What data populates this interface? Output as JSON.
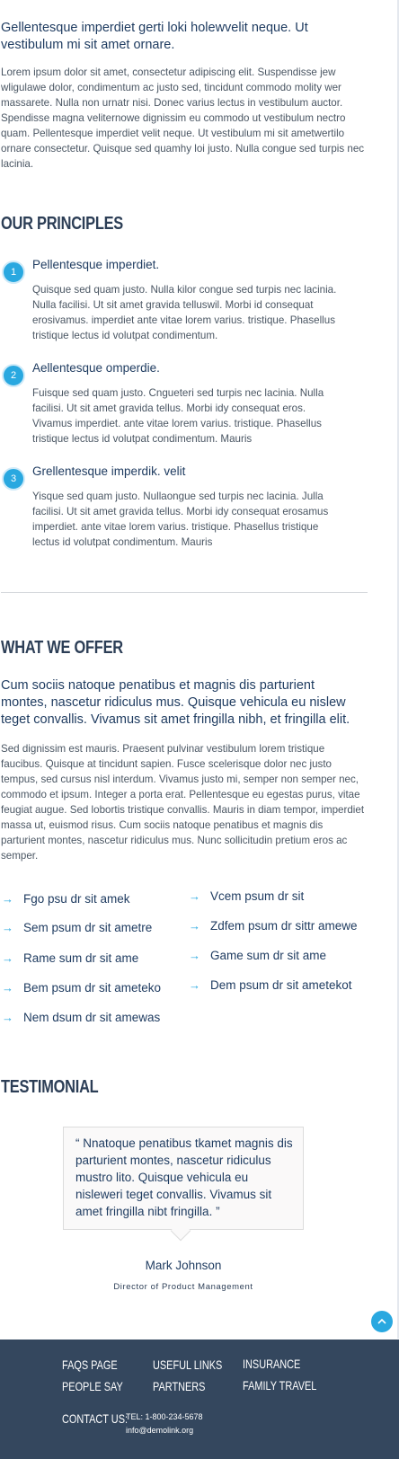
{
  "intro": {
    "lead": "Gellentesque imperdiet gerti loki holewvelit neque. Ut vestibulum mi sit amet ornare.",
    "body": "Lorem ipsum dolor sit amet, consectetur adipiscing elit. Suspendisse jew wligulawe dolor, condimentum ac justo sed, tincidunt commodo molity wer massarete. Nulla non urnatr nisi. Donec varius lectus in vestibulum auctor. Spendisse magna veliternowe dignissim eu commodo ut vestibulum nectro quam. Pellentesque imperdiet velit neque. Ut vestibulum mi sit ametwertilo ornare consectetur. Quisque sed quamhy loi justo. Nulla congue sed turpis nec lacinia."
  },
  "principles": {
    "title": "OUR PRINCIPLES",
    "items": [
      {
        "num": "1",
        "title": "Pellentesque imperdiet.",
        "text": "Quisque sed quam justo. Nulla kilor congue sed turpis nec lacinia. Nulla facilisi. Ut sit amet gravida telluswil. Morbi id consequat erosivamus. imperdiet ante vitae lorem varius. tristique. Phasellus tristique lectus id volutpat condimentum."
      },
      {
        "num": "2",
        "title": "Aellentesque omperdie.",
        "text": "Fuisque sed quam justo. Cngueteri sed turpis nec lacinia. Nulla facilisi. Ut sit amet gravida tellus. Morbi idy consequat eros. Vivamus imperdiet. ante vitae lorem varius. tristique. Phasellus tristique lectus id volutpat condimentum. Mauris"
      },
      {
        "num": "3",
        "title": "Grellentesque imperdik. velit",
        "text": "Yisque sed quam justo. Nullaongue sed turpis nec lacinia. Julla facilisi. Ut sit amet gravida tellus. Morbi idy consequat erosamus imperdiet. ante vitae lorem varius. tristique. Phasellus tristique lectus id volutpat condimentum. Mauris"
      }
    ]
  },
  "offer": {
    "title": "WHAT WE OFFER",
    "lead": "Cum sociis natoque penatibus et magnis dis parturient montes, nascetur ridiculus mus. Quisque vehicula eu nislew teget convallis. Vivamus sit amet fringilla nibh, et fringilla elit.",
    "body": "Sed dignissim est mauris. Praesent pulvinar vestibulum lorem tristique faucibus. Quisque at tincidunt sapien. Fusce scelerisque dolor nec justo tempus, sed cursus nisl interdum. Vivamus justo mi, semper non semper nec, commodo et ipsum. Integer a porta erat. Pellentesque eu egestas purus, vitae feugiat augue. Sed lobortis tristique convallis. Mauris in diam tempor, imperdiet massa ut, euismod risus. Cum sociis natoque penatibus et magnis dis parturient montes, nascetur ridiculus mus. Nunc sollicitudin pretium eros ac semper.",
    "arrow": "→",
    "left_items": [
      "Fgo psu dr sit amek",
      "Sem psum dr sit ametre",
      "Rame sum dr sit ame",
      "Bem psum dr sit ameteko",
      "Nem dsum dr sit amewas"
    ],
    "right_items": [
      "Vcem psum dr sit",
      "Zdfem psum dr sittr amewe",
      "Game sum dr sit ame",
      "Dem psum dr sit ametekot"
    ]
  },
  "testimonial": {
    "title": "TESTIMONIAL",
    "quote": "“ Nnatoque penatibus tkamet magnis dis parturient montes, nascetur ridiculus mustro  lito. Quisque vehicula eu nisleweri teget convallis. Vivamus sit amet fringilla nibt fringilla. ”",
    "author": "Mark Johnson",
    "role": "Director of Product Management"
  },
  "footer": {
    "links_col1": [
      "FAQS PAGE",
      "PEOPLE SAY"
    ],
    "links_col2": [
      "USEFUL LINKS",
      "PARTNERS"
    ],
    "links_col3": [
      "INSURANCE",
      "FAMILY TRAVEL"
    ],
    "contact_label": "CONTACT US:",
    "tel": "TEL: 1-800-234-5678",
    "email": "info@demolink.org"
  },
  "icons": {
    "back_to_top": "chevron-up-icon",
    "list_arrow": "arrow-right-icon"
  },
  "colors": {
    "accent": "#29a8e0",
    "heading": "#1d3a5f",
    "footer_bg": "#34475e"
  }
}
